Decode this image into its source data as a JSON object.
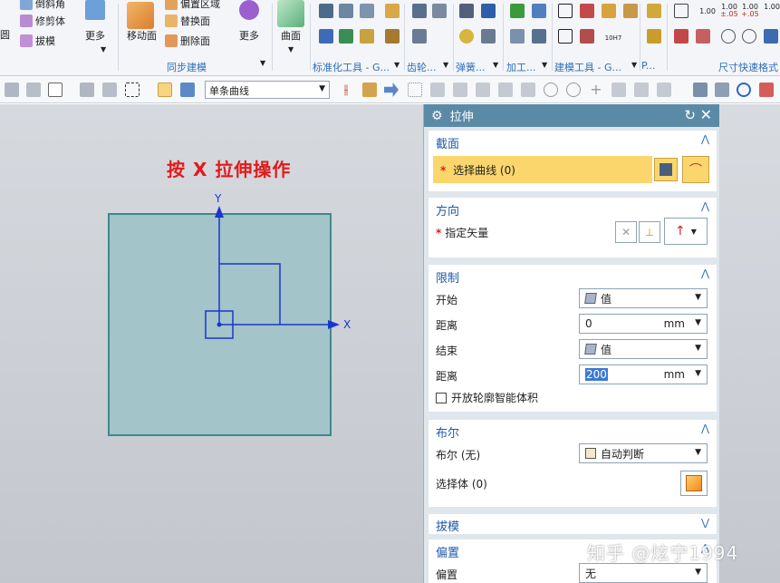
{
  "ribbon": {
    "left_items": [
      "倒斜角",
      "修剪体",
      "拔模"
    ],
    "left_cut_label": "圆",
    "more_label_1": "更多",
    "move_face_label": "移动面",
    "sync_items": [
      "偏置区域",
      "替换面",
      "删除面"
    ],
    "more_label_2": "更多",
    "surface_label": "曲面",
    "group_labels": {
      "sync": "同步建模",
      "standard_tools": "标准化工具 - G...",
      "gear": "齿轮...",
      "spring": "弹簧...",
      "machining": "加工...",
      "modeling_tools": "建模工具 - G...",
      "p": "P...",
      "dimension": "尺寸快速格式"
    },
    "mini_values": [
      "1.00",
      "1.00",
      "1.00",
      "1.00"
    ],
    "mini_sub": [
      "±.05",
      "1.00",
      "+.05"
    ],
    "tolerance_label": "10H7"
  },
  "toolbar2": {
    "curve_filter": "单条曲线"
  },
  "canvas": {
    "title": "按 X 拉伸操作",
    "axis_x": "X",
    "axis_y": "Y"
  },
  "dialog": {
    "title": "拉伸",
    "section_section": {
      "title": "截面",
      "select_curve": "选择曲线 (0)"
    },
    "section_direction": {
      "title": "方向",
      "specify_vector": "指定矢量"
    },
    "section_limits": {
      "title": "限制",
      "start_label": "开始",
      "start_value": "值",
      "distance_label": "距离",
      "start_distance": "0",
      "unit": "mm",
      "end_label": "结束",
      "end_value": "值",
      "end_distance": "200",
      "open_profile": "开放轮廓智能体积"
    },
    "section_boolean": {
      "title": "布尔",
      "boolean_label": "布尔 (无)",
      "boolean_value": "自动判断",
      "select_body": "选择体 (0)"
    },
    "section_draft": {
      "title": "拔模"
    },
    "section_offset": {
      "title": "偏置",
      "offset_label": "偏置",
      "offset_value": "无"
    }
  },
  "watermark": "知乎 @炫宁1994",
  "colors": {
    "accent": "#1f5aa8",
    "required": "#e21a1a",
    "selection_highlight": "#fbd66d",
    "dialog_title_bg": "#5b8aa7",
    "plate_fill": "#a3c4c8",
    "axis": "#1a35d0"
  },
  "icons": {
    "gear": "gear-icon",
    "reset": "reset-icon",
    "close": "close-icon",
    "chevron_up": "chevron-up-icon",
    "chevron_down": "chevron-down-icon"
  }
}
